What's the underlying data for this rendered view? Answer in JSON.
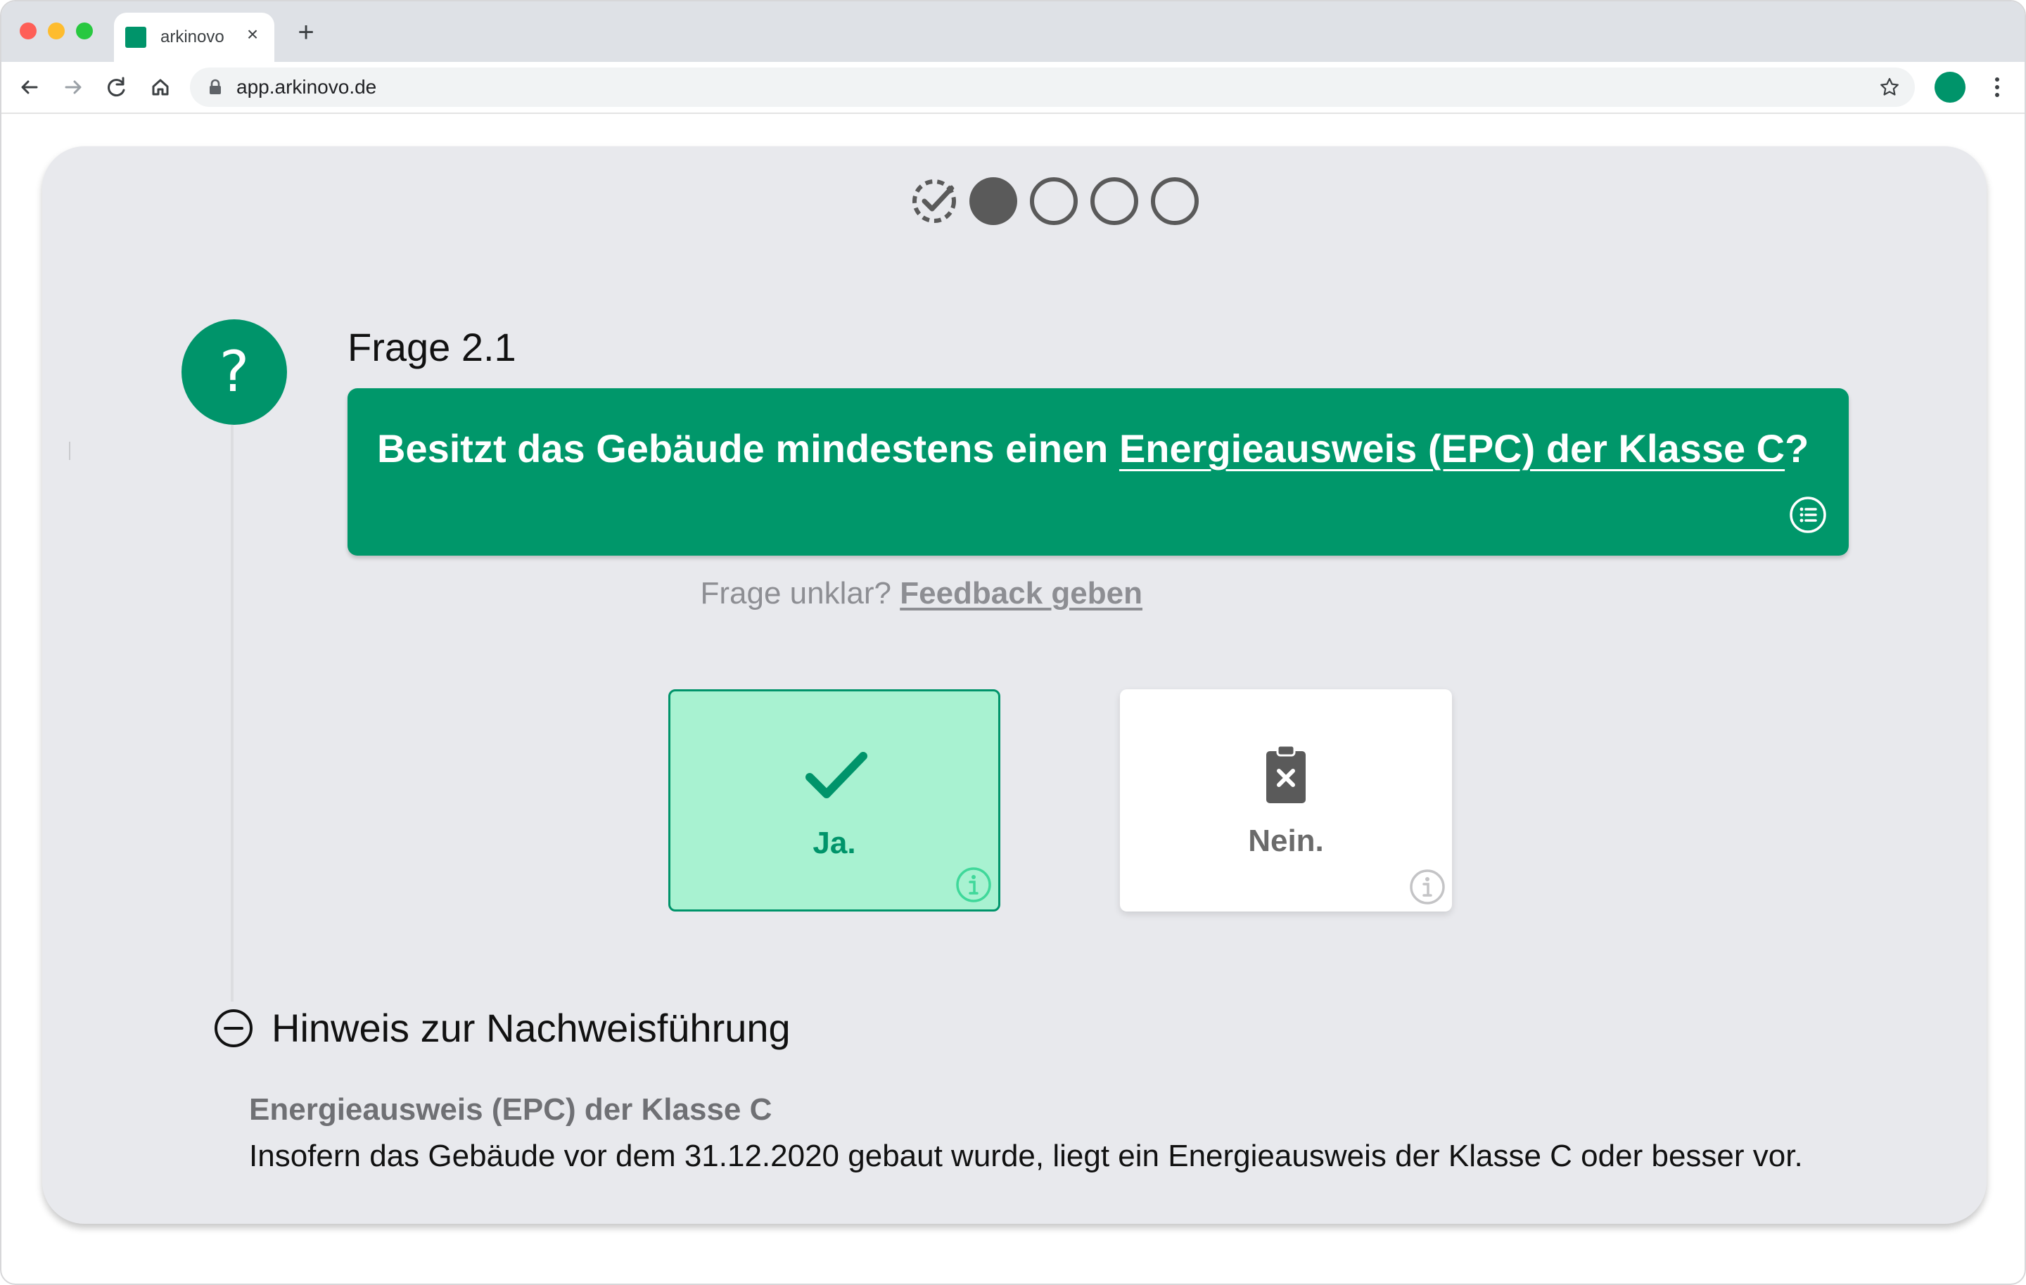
{
  "browser": {
    "tab_title": "arkinovo",
    "url": "app.arkinovo.de",
    "colors": {
      "favicon": "#00946a",
      "profile": "#00946a"
    }
  },
  "progress": {
    "total_steps": 5,
    "completed_steps": 1,
    "current_step": 2
  },
  "question": {
    "label": "Frage 2.1",
    "badge_symbol": "?",
    "text_before": "Besitzt das Gebäude mindestens einen ",
    "text_link": "Energieausweis (EPC) der Klasse C",
    "text_after": "?",
    "color": "#00976a"
  },
  "feedback": {
    "prompt": "Frage unklar? ",
    "link": "Feedback geben"
  },
  "answers": {
    "yes": {
      "label": "Ja.",
      "icon": "check-icon",
      "selected": true
    },
    "no": {
      "label": "Nein.",
      "icon": "clipboard-x-icon",
      "selected": false
    }
  },
  "hint": {
    "title": "Hinweis zur Nachweisführung",
    "subtitle": "Energieausweis (EPC) der Klasse C",
    "body": "Insofern das Gebäude vor dem 31.12.2020 gebaut wurde, liegt ein Energieausweis der Klasse C oder besser vor."
  }
}
